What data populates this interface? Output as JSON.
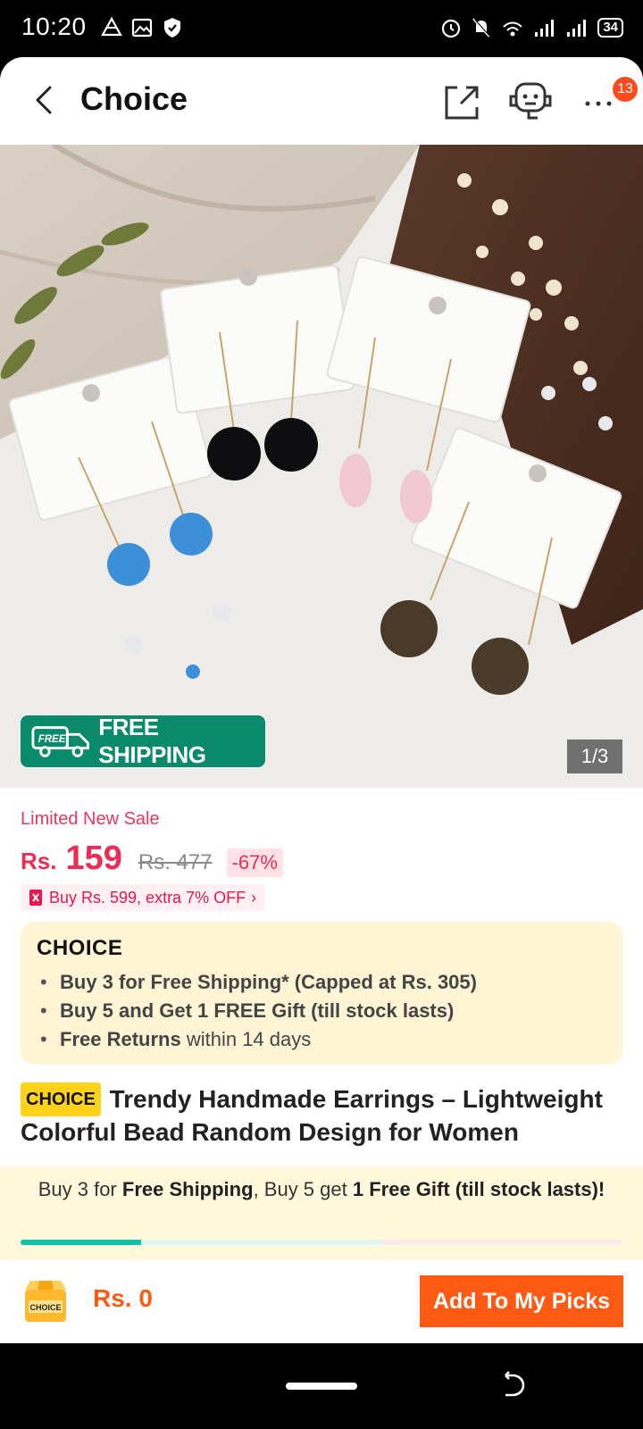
{
  "status_bar": {
    "time": "10:20",
    "battery": "34",
    "left_icons": [
      "drive-icon",
      "gallery-icon",
      "shield-icon"
    ],
    "right_icons": [
      "alarm-icon",
      "mute-icon",
      "wifi-icon",
      "signal-icon",
      "signal-icon",
      "battery-icon"
    ]
  },
  "header": {
    "title": "Choice",
    "notification_count": "13"
  },
  "gallery": {
    "free_shipping_label": "FREE SHIPPING",
    "free_badge_text": "FREE",
    "counter": "1/3"
  },
  "pricing": {
    "sale_label": "Limited New Sale",
    "currency": "Rs.",
    "price": "159",
    "original_price": "Rs. 477",
    "discount": "-67%",
    "coupon": "Buy Rs. 599, extra 7% OFF"
  },
  "choice": {
    "logo": "CHOICE",
    "benefits": [
      {
        "bold": "Buy 3 for  Free Shipping* (Capped at Rs. 305)",
        "rest": ""
      },
      {
        "bold": "Buy 5 and Get 1 FREE Gift (till stock lasts)",
        "rest": ""
      },
      {
        "bold": "Free Returns",
        "rest": " within 14 days"
      }
    ]
  },
  "product": {
    "tag": "CHOICE",
    "title": "Trendy Handmade Earrings – Lightweight Colorful Bead Random Design for Women"
  },
  "promo": {
    "part1": "Buy 3 for ",
    "bold1": "Free Shipping",
    "part2": ", Buy 5 get ",
    "bold2": "1 Free Gift (till stock lasts)!",
    "progress": 0.2
  },
  "bottom": {
    "cart_logo_text": "CHOICE",
    "total": "Rs. 0",
    "add_button": "Add To My Picks"
  },
  "colors": {
    "accent": "#ff5a14",
    "price": "#ee2b53",
    "free_shipping": "#0a8a6b",
    "progress": "#13bfa8"
  }
}
